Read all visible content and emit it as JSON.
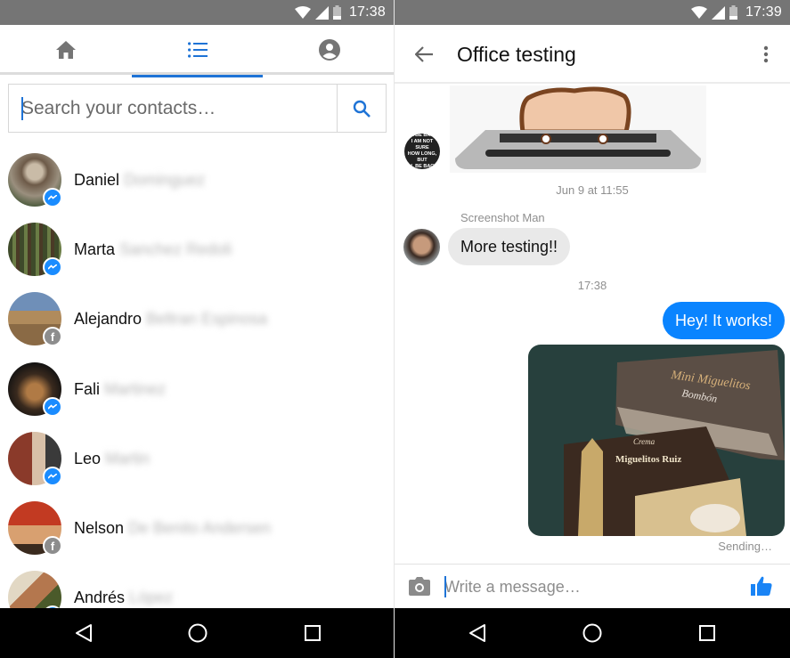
{
  "left": {
    "status_bar": {
      "time": "17:38",
      "icons": [
        "wifi-icon",
        "signal-icon",
        "battery-icon"
      ]
    },
    "tabs": [
      {
        "name": "home",
        "icon": "home-icon",
        "active": false
      },
      {
        "name": "contacts",
        "icon": "list-icon",
        "active": true
      },
      {
        "name": "profile",
        "icon": "account-circle-icon",
        "active": false
      }
    ],
    "search": {
      "placeholder": "Search your contacts…",
      "value": "",
      "button_icon": "search-icon"
    },
    "contacts": [
      {
        "first_name": "Daniel",
        "last_name": "Dominguez",
        "badge": "messenger"
      },
      {
        "first_name": "Marta",
        "last_name": "Sanchez Redoli",
        "badge": "messenger"
      },
      {
        "first_name": "Alejandro",
        "last_name": "Beltran Espinosa",
        "badge": "facebook"
      },
      {
        "first_name": "Fali",
        "last_name": "Martinez",
        "badge": "messenger"
      },
      {
        "first_name": "Leo",
        "last_name": "Martin",
        "badge": "messenger"
      },
      {
        "first_name": "Nelson",
        "last_name": "De Benito Andersen",
        "badge": "facebook"
      },
      {
        "first_name": "Andrés",
        "last_name": "López",
        "badge": "messenger"
      }
    ],
    "nav": [
      "back-icon",
      "home-circle-icon",
      "recents-square-icon"
    ]
  },
  "right": {
    "status_bar": {
      "time": "17:39",
      "icons": [
        "wifi-icon",
        "signal-icon",
        "battery-icon"
      ]
    },
    "header": {
      "title": "Office testing",
      "back_icon": "arrow-left-icon",
      "menu_icon": "more-vert-icon"
    },
    "messages": {
      "gif_avatar_text": [
        "I'LL BE BACK.",
        "I AM NOT SURE",
        "HOW LONG, BUT",
        "I'LL BE BACK."
      ],
      "timestamp_1": "Jun 9 at 11:55",
      "sender_name": "Screenshot Man",
      "incoming_text": "More testing!!",
      "timestamp_2": "17:38",
      "outgoing_text": "Hey! It works!",
      "photo_labels": {
        "box1_brand": "Mini Miguelitos",
        "box1_flavor": "Bombón",
        "box2_flavor": "Crema",
        "box2_brand": "Miguelitos Ruiz"
      },
      "status": "Sending…"
    },
    "composer": {
      "placeholder": "Write a message…",
      "value": "",
      "camera_icon": "camera-icon",
      "like_icon": "thumbs-up-icon"
    },
    "nav": [
      "back-icon",
      "home-circle-icon",
      "recents-square-icon"
    ]
  },
  "colors": {
    "accent": "#1e73d6",
    "messenger_blue": "#0a84ff",
    "status_bar": "#757575",
    "incoming_bubble": "#e9e9e9"
  }
}
